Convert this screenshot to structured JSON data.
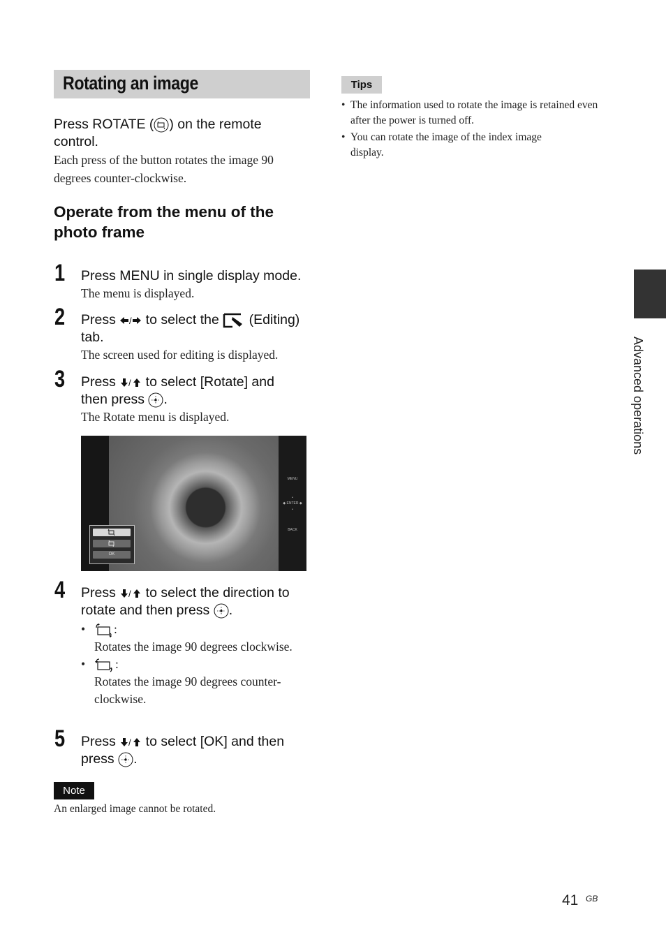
{
  "section": {
    "title": "Rotating an image",
    "lead_before_icon": "Press ROTATE (",
    "lead_icon": "rotate-button-icon",
    "lead_after_icon": ") on the remote",
    "lead_line2": "control.",
    "lead_desc": "Each press of the button rotates the image 90 degrees counter-clockwise."
  },
  "subsection": {
    "heading": "Operate from the menu of the photo frame"
  },
  "steps": [
    {
      "number": "1",
      "text": "Press MENU in single display mode.",
      "desc": "The menu is displayed."
    },
    {
      "number": "2",
      "text_before": "Press ",
      "arrows": "◆/◆",
      "text_mid": " to select the ",
      "icon": "editing-tab-icon",
      "text_after": " (Editing)",
      "text_line2": "tab.",
      "desc": "The screen used for editing is displayed."
    },
    {
      "number": "3",
      "text_before": "Press ",
      "arrows": "↓/↑",
      "text_mid": " to select [Rotate] and",
      "text_line2": "then press ",
      "icon": "enter-button-icon",
      "desc": "The Rotate menu is displayed."
    },
    {
      "number": "4",
      "text_before": "Press ",
      "arrows": "↓/↑",
      "text_mid": " to select the direction to",
      "text_line2": "rotate and then press ",
      "options": [
        {
          "icon": "rotate-clockwise-icon",
          "desc": "Rotates the image 90 degrees clockwise."
        },
        {
          "icon": "rotate-counterclockwise-icon",
          "desc": "Rotates the image 90 degrees counter-clockwise."
        }
      ]
    },
    {
      "number": "5",
      "text_before": "Press ",
      "arrows": "↓/↑",
      "text_mid": " to select [OK] and then",
      "text_line2": "press "
    }
  ],
  "screen": {
    "side_labels": {
      "menu": "MENU",
      "enter": "ENTER",
      "back": "BACK"
    },
    "menu_buttons": [
      "rotate-clockwise",
      "rotate-counterclockwise",
      "OK"
    ],
    "ok_label": "OK"
  },
  "note": {
    "label": "Note",
    "text": "An enlarged image cannot be rotated."
  },
  "tips": {
    "label": "Tips",
    "items": [
      "The information used to rotate the image is retained even after the power is turned off.",
      "You can rotate the image of the index image display."
    ]
  },
  "side": {
    "chapter": "Advanced operations"
  },
  "footer": {
    "page": "41",
    "suffix": "GB"
  }
}
